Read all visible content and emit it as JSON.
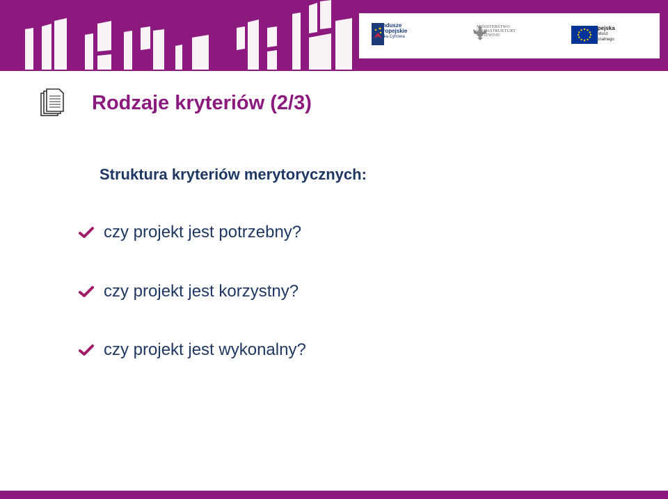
{
  "colors": {
    "brand_purple": "#8c1a7e",
    "text_navy": "#1f3863",
    "check_mark": "#a21a6a",
    "fe_blue": "#1b3a7a",
    "fe_red": "#d4213d",
    "eu_blue": "#003399",
    "eu_star": "#ffcc00"
  },
  "header": {
    "logos": {
      "fundusze": {
        "icon": "fundusze-europejskie-logo",
        "line1": "Fundusze",
        "line2": "Europejskie",
        "line3": "Polska Cyfrowa"
      },
      "ministerstwo": {
        "icon": "polish-eagle-emblem",
        "line1": "MINISTERSTWO",
        "line2": "INFRASTRUKTURY",
        "line3": "I ROZWOJU"
      },
      "ue": {
        "icon": "eu-flag",
        "line1": "Unia Europejska",
        "line2": "Europejski Fundusz",
        "line3": "Rozwoju Regionalnego"
      }
    }
  },
  "slide": {
    "icon": "documents-icon",
    "title": "Rodzaje kryteriów (2/3)",
    "subtitle": "Struktura kryteriów merytorycznych:",
    "bullets": [
      {
        "icon": "check-icon",
        "text": "czy projekt jest potrzebny?"
      },
      {
        "icon": "check-icon",
        "text": "czy projekt jest korzystny?"
      },
      {
        "icon": "check-icon",
        "text": "czy projekt jest wykonalny?"
      }
    ]
  }
}
